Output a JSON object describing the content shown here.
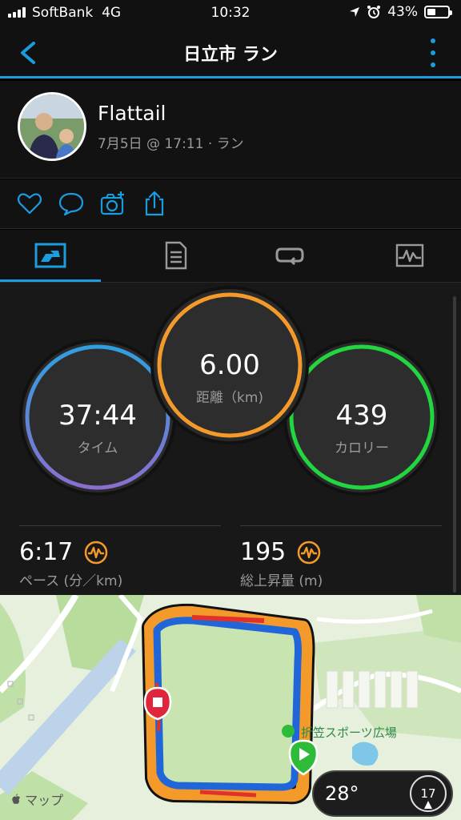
{
  "status_bar": {
    "carrier": "SoftBank",
    "network": "4G",
    "time": "10:32",
    "battery": "43%",
    "battery_level": 0.43
  },
  "nav": {
    "title": "日立市 ラン",
    "back_icon": "chevron-left-icon",
    "menu_icon": "more-vertical-icon"
  },
  "profile": {
    "name": "Flattail",
    "meta": "7月5日 @ 17:11 · ラン"
  },
  "actions": [
    "heart-icon",
    "comment-icon",
    "add-photo-icon",
    "share-icon"
  ],
  "tabs": [
    "overview-tab",
    "details-tab",
    "laps-tab",
    "charts-tab"
  ],
  "rings": {
    "time": {
      "value": "37:44",
      "label": "タイム"
    },
    "distance": {
      "value": "6.00",
      "label": "距離（km)"
    },
    "calories": {
      "value": "439",
      "label": "カロリー"
    }
  },
  "metrics": {
    "pace": {
      "value": "6:17",
      "label": "ペース (分／km)"
    },
    "elevation": {
      "value": "195",
      "label": "総上昇量 (m)"
    }
  },
  "map": {
    "place": "折笠スポーツ広場",
    "provider": "マップ",
    "temperature": "28°",
    "wind": "17"
  },
  "colors": {
    "accent": "#1a9de0",
    "time_ring_top": "#2f9fe0",
    "time_ring_bottom": "#8a6fd0",
    "distance_ring": "#f39a2b",
    "calories_ring": "#22d640",
    "badge": "#f39a2b"
  }
}
